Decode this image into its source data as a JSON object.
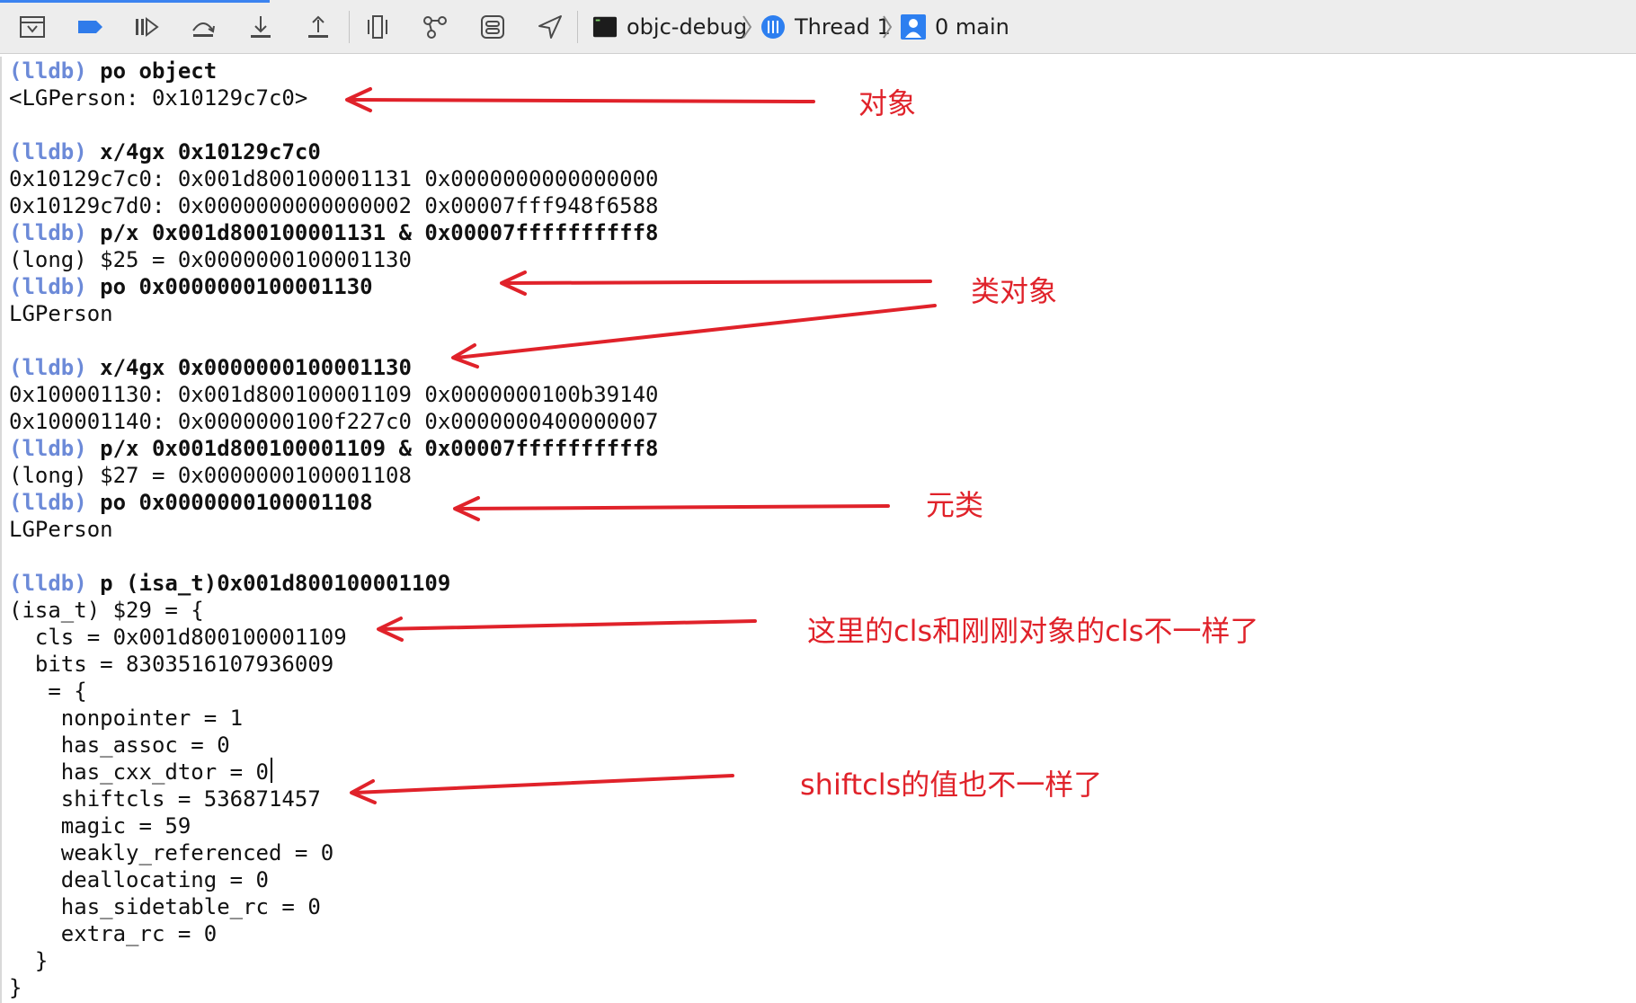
{
  "toolbar": {
    "icons": [
      "hide-console-icon",
      "breakpoint-icon",
      "continue-icon",
      "step-over-icon",
      "step-in-icon",
      "step-out-icon",
      "debug-view-hierarchy-icon",
      "memory-graph-icon",
      "environment-overrides-icon",
      "simulate-location-icon"
    ],
    "scheme": "objc-debug",
    "thread": "Thread 1",
    "frame": "0 main"
  },
  "console": {
    "prompt": "(lldb)",
    "lines": [
      {
        "prompt": true,
        "cmd": "po object"
      },
      {
        "text": "<LGPerson: 0x10129c7c0>"
      },
      {
        "text": ""
      },
      {
        "prompt": true,
        "cmd": "x/4gx 0x10129c7c0"
      },
      {
        "text": "0x10129c7c0: 0x001d800100001131 0x0000000000000000"
      },
      {
        "text": "0x10129c7d0: 0x0000000000000002 0x00007fff948f6588"
      },
      {
        "prompt": true,
        "cmd": "p/x 0x001d800100001131 & 0x00007ffffffffff8"
      },
      {
        "text": "(long) $25 = 0x0000000100001130"
      },
      {
        "prompt": true,
        "cmd": "po 0x0000000100001130"
      },
      {
        "text": "LGPerson"
      },
      {
        "text": ""
      },
      {
        "prompt": true,
        "cmd": "x/4gx 0x0000000100001130"
      },
      {
        "text": "0x100001130: 0x001d800100001109 0x0000000100b39140"
      },
      {
        "text": "0x100001140: 0x0000000100f227c0 0x0000000400000007"
      },
      {
        "prompt": true,
        "cmd": "p/x 0x001d800100001109 & 0x00007ffffffffff8"
      },
      {
        "text": "(long) $27 = 0x0000000100001108"
      },
      {
        "prompt": true,
        "cmd": "po 0x0000000100001108"
      },
      {
        "text": "LGPerson"
      },
      {
        "text": ""
      },
      {
        "prompt": true,
        "cmd": "p (isa_t)0x001d800100001109"
      },
      {
        "text": "(isa_t) $29 = {"
      },
      {
        "text": "  cls = 0x001d800100001109"
      },
      {
        "text": "  bits = 8303516107936009"
      },
      {
        "text": "   = {"
      },
      {
        "text": "    nonpointer = 1"
      },
      {
        "text": "    has_assoc = 0"
      },
      {
        "text": "    has_cxx_dtor = 0"
      },
      {
        "text": "    shiftcls = 536871457"
      },
      {
        "text": "    magic = 59"
      },
      {
        "text": "    weakly_referenced = 0"
      },
      {
        "text": "    deallocating = 0"
      },
      {
        "text": "    has_sidetable_rc = 0"
      },
      {
        "text": "    extra_rc = 0"
      },
      {
        "text": "  }"
      },
      {
        "text": "}"
      }
    ]
  },
  "annotations": {
    "object": "对象",
    "class_object": "类对象",
    "metaclass": "元类",
    "cls_differs": "这里的cls和刚刚对象的cls不一样了",
    "shiftcls_differs": "shiftcls的值也不一样了"
  },
  "colors": {
    "annotation": "#e0222a",
    "prompt": "#6c8ad8",
    "toolbar_bg": "#ededed"
  }
}
